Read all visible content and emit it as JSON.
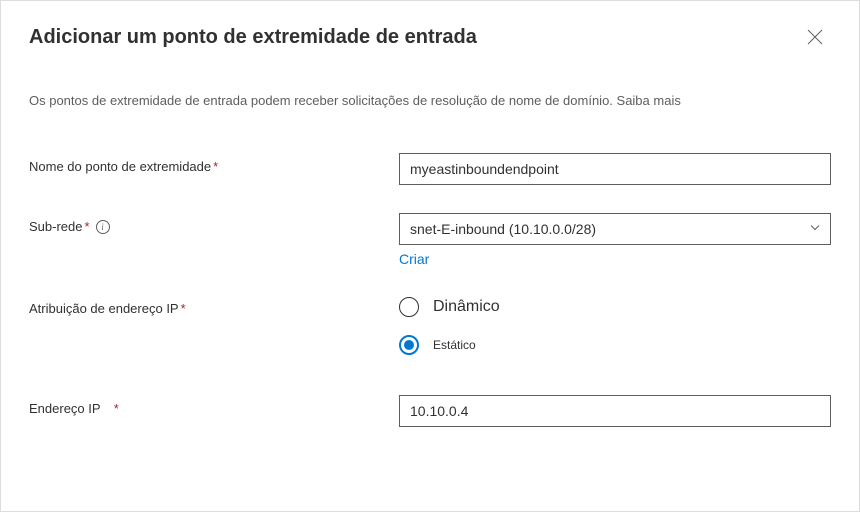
{
  "header": {
    "title": "Adicionar um ponto de extremidade de entrada"
  },
  "description": "Os pontos de extremidade de entrada podem receber solicitações de resolução de nome de domínio. Saiba mais",
  "form": {
    "endpointName": {
      "label": "Nome do ponto de extremidade",
      "required": "*",
      "value": "myeastinboundendpoint"
    },
    "subnet": {
      "label": "Sub-rede",
      "required": "*",
      "value": "snet-E-inbound (10.10.0.0/28)",
      "createLink": "Criar"
    },
    "ipAssignment": {
      "label": "Atribuição de endereço IP",
      "required": "*",
      "options": {
        "dynamic": "Dinâmico",
        "static": "Estático"
      }
    },
    "ipAddress": {
      "label": "Endereço IP",
      "required": "*",
      "value": "10.10.0.4"
    }
  }
}
